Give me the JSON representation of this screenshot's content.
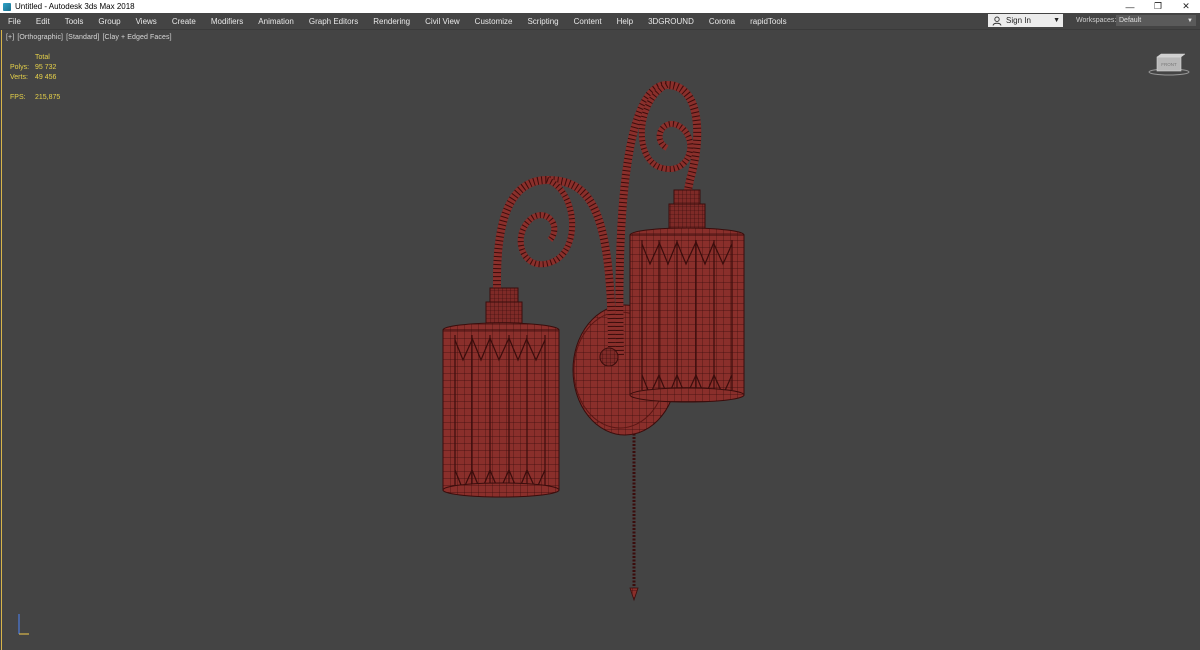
{
  "window": {
    "title": "Untitled - Autodesk 3ds Max 2018",
    "controls": {
      "minimize": "—",
      "restore": "❐",
      "close": "✕"
    }
  },
  "menu": {
    "items": [
      "File",
      "Edit",
      "Tools",
      "Group",
      "Views",
      "Create",
      "Modifiers",
      "Animation",
      "Graph Editors",
      "Rendering",
      "Civil View",
      "Customize",
      "Scripting",
      "Content",
      "Help",
      "3DGROUND",
      "Corona",
      "rapidTools"
    ],
    "sign_in": "Sign In",
    "workspaces_label": "Workspaces:",
    "workspaces_value": "Default"
  },
  "viewport": {
    "label_parts": [
      "[+]",
      "[Orthographic]",
      "[Standard]",
      "[Clay + Edged Faces]"
    ],
    "stats": {
      "header": "Total",
      "polys_label": "Polys:",
      "polys_value": "95 732",
      "verts_label": "Verts:",
      "verts_value": "49 456",
      "fps_label": "FPS:",
      "fps_value": "215,875"
    }
  },
  "icons": {
    "app": "3ds-max-app-icon",
    "user": "user-icon",
    "viewcube": "viewcube-icon",
    "axis": "axis-tripod-icon"
  },
  "colors": {
    "viewport_bg": "#444444",
    "model_fill": "#8a2f2b",
    "wire": "#3a0d0c",
    "stats_text": "#e7d24a",
    "active_border": "#d9b54a"
  }
}
